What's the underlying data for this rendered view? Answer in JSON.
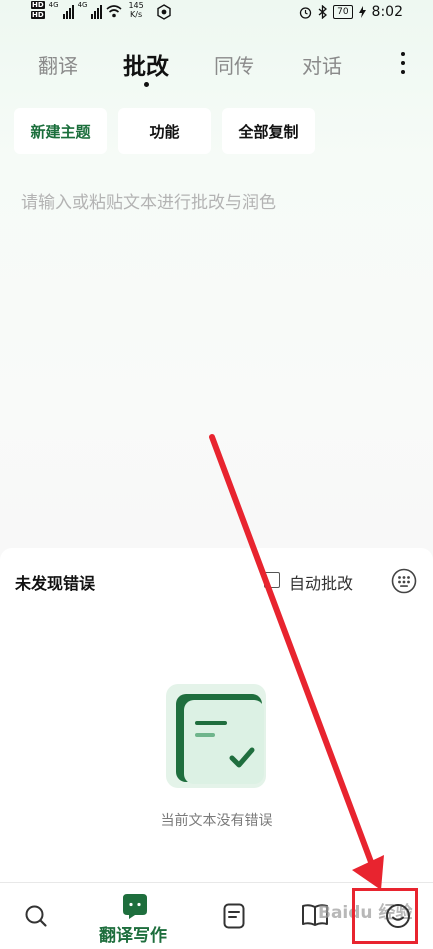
{
  "status_bar": {
    "hd_1": "HD",
    "hd_2": "HD",
    "net_1": "4G",
    "net_2": "4G",
    "speed_value": "145",
    "speed_unit": "K/s",
    "battery": "70",
    "time": "8:02",
    "icons": [
      "signal-bars-icon",
      "wifi-icon",
      "app-notification-icon",
      "alarm-icon",
      "bluetooth-icon",
      "charging-icon"
    ]
  },
  "tabs": [
    {
      "label": "翻译",
      "active": false
    },
    {
      "label": "批改",
      "active": true
    },
    {
      "label": "同传",
      "active": false
    },
    {
      "label": "对话",
      "active": false
    }
  ],
  "toolbar": {
    "new_topic": "新建主题",
    "functions": "功能",
    "copy_all": "全部复制"
  },
  "editor": {
    "placeholder": "请输入或粘贴文本进行批改与润色"
  },
  "result_panel": {
    "title": "未发现错误",
    "auto_correct_label": "自动批改",
    "auto_correct_checked": false,
    "empty_text": "当前文本没有错误"
  },
  "bottom_nav": {
    "items": [
      {
        "icon": "search-icon"
      },
      {
        "icon": "chat-bubble-icon",
        "label": "翻译写作",
        "active": true
      },
      {
        "icon": "note-icon"
      },
      {
        "icon": "book-icon"
      },
      {
        "icon": "profile-icon"
      }
    ]
  },
  "watermark": "Baidu 经验",
  "colors": {
    "accent": "#1e6e3d",
    "accent_light": "#dff2e6",
    "annotation_red": "#e8242f"
  }
}
